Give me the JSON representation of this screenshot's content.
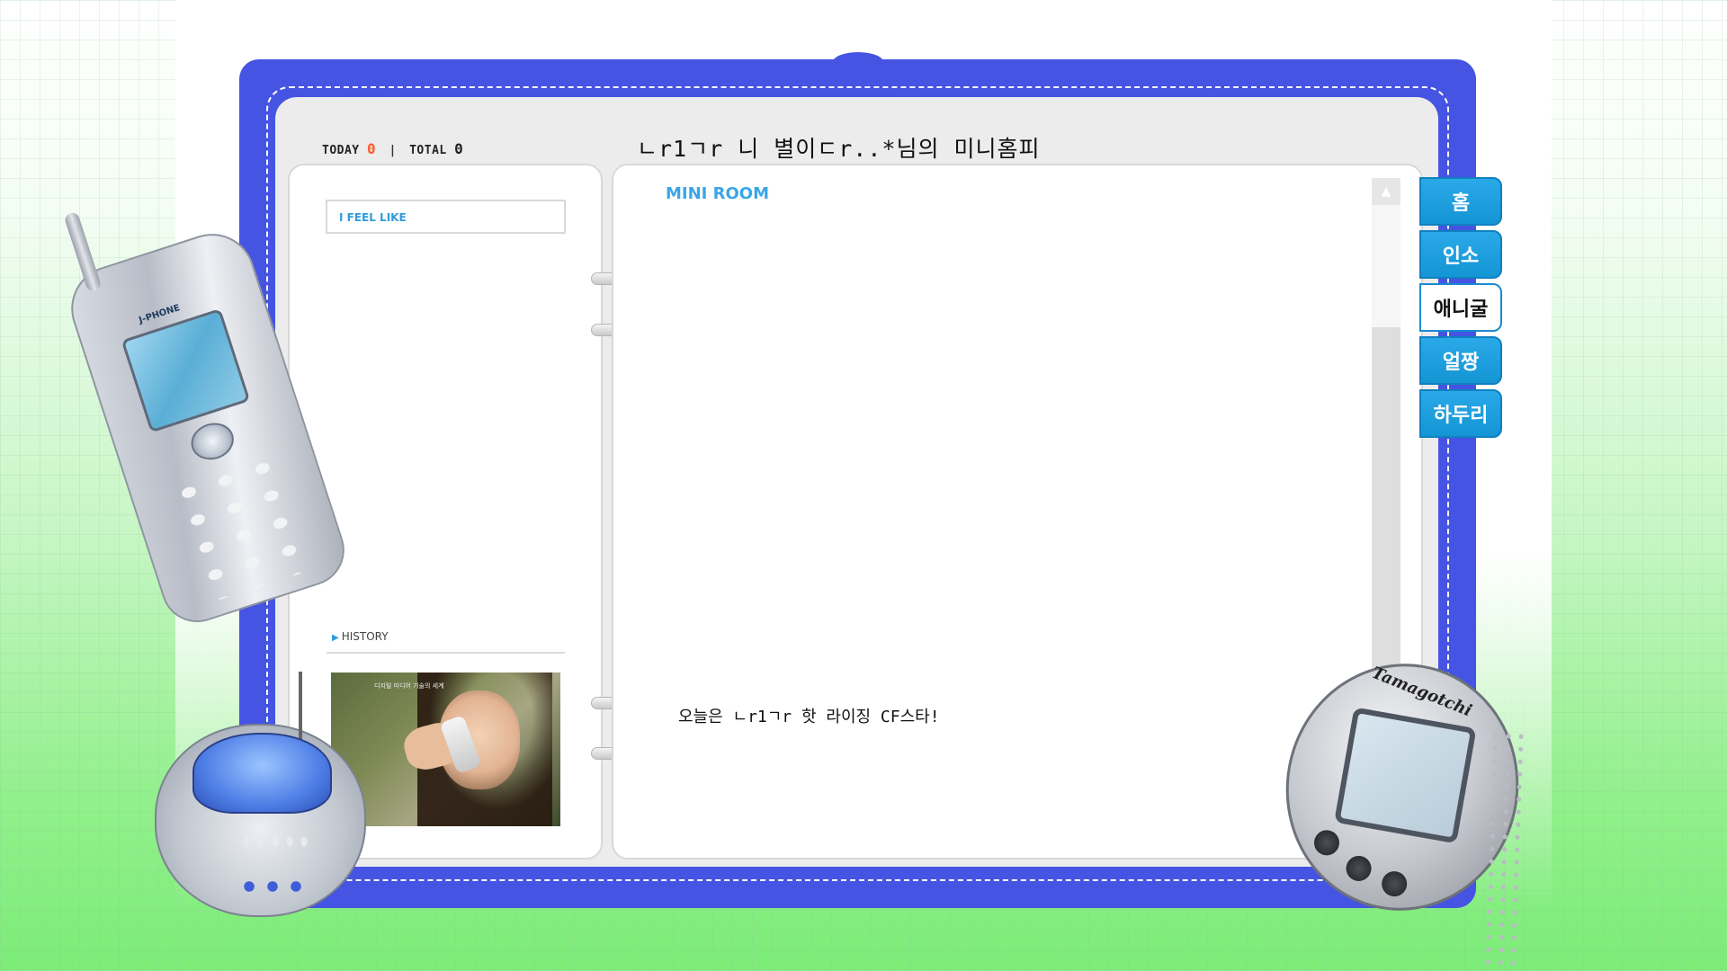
{
  "counter": {
    "today_label": "TODAY",
    "today_value": "0",
    "separator": "|",
    "total_label": "TOTAL",
    "total_value": "0"
  },
  "homepage": {
    "title": "ㄴr1ㄱr 니 별이ㄷr..*님의 미니홈피"
  },
  "left_panel": {
    "feel_label": "I FEEL LIKE",
    "history_label": "HISTORY",
    "history_image_caption": "디지털 미디어 기술의 세계"
  },
  "main_panel": {
    "section_title": "MINI ROOM",
    "caption": "오늘은 ㄴr1ㄱr 핫 라이징 CF스타!"
  },
  "scrollbar": {
    "up_arrow": "▲"
  },
  "tabs": [
    {
      "label": "홈",
      "active": true
    },
    {
      "label": "인소",
      "active": true
    },
    {
      "label": "애니굴",
      "active": false
    },
    {
      "label": "얼짱",
      "active": true
    },
    {
      "label": "하두리",
      "active": true
    }
  ],
  "decorations": {
    "phone_brand": "J-PHONE",
    "tamagotchi_brand": "Tamagotchi"
  },
  "colors": {
    "binder_blue": "#4554e2",
    "accent_orange": "#ff5a2c",
    "accent_sky": "#3aa6e8",
    "tab_blue": "#1495d4"
  }
}
